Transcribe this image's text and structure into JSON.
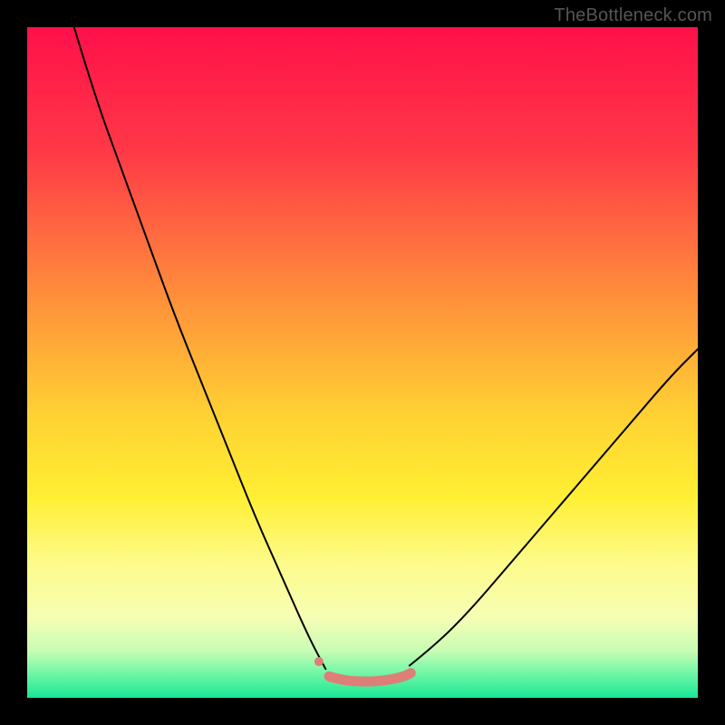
{
  "watermark": "TheBottleneck.com",
  "chart_data": {
    "type": "line",
    "title": "",
    "xlabel": "",
    "ylabel": "",
    "xlim": [
      0,
      100
    ],
    "ylim": [
      0,
      100
    ],
    "gradient_stops": [
      {
        "offset": 0,
        "color": "#ff104a"
      },
      {
        "offset": 18,
        "color": "#ff3747"
      },
      {
        "offset": 40,
        "color": "#ff8e3b"
      },
      {
        "offset": 58,
        "color": "#ffd233"
      },
      {
        "offset": 70,
        "color": "#ffef33"
      },
      {
        "offset": 80,
        "color": "#fdfb8b"
      },
      {
        "offset": 88,
        "color": "#f6feb4"
      },
      {
        "offset": 93,
        "color": "#c8fcb4"
      },
      {
        "offset": 96,
        "color": "#7af7a8"
      },
      {
        "offset": 100,
        "color": "#18e794"
      }
    ],
    "series": [
      {
        "name": "left-curve-black",
        "color": "#000000",
        "stroke_width": 2,
        "x": [
          7,
          10,
          14,
          18,
          22,
          26,
          30,
          34,
          38,
          42,
          44.5
        ],
        "y": [
          100,
          90,
          79,
          68,
          57,
          47,
          37,
          27,
          18,
          9,
          4.3
        ]
      },
      {
        "name": "right-curve-black",
        "color": "#000000",
        "stroke_width": 2,
        "x": [
          57,
          61,
          66,
          72,
          78,
          84,
          90,
          96,
          100
        ],
        "y": [
          4.8,
          8,
          13,
          20,
          27,
          34,
          41,
          48,
          52
        ]
      },
      {
        "name": "trough-highlight",
        "color": "#dd7f77",
        "stroke_width": 11,
        "x": [
          45,
          47,
          50,
          53,
          56,
          57.2
        ],
        "y": [
          3.2,
          2.6,
          2.4,
          2.5,
          3.1,
          3.7
        ]
      }
    ],
    "markers": [
      {
        "name": "trough-dot",
        "x": 43.5,
        "y": 5.4,
        "r": 5,
        "color": "#dd7f77"
      }
    ]
  }
}
